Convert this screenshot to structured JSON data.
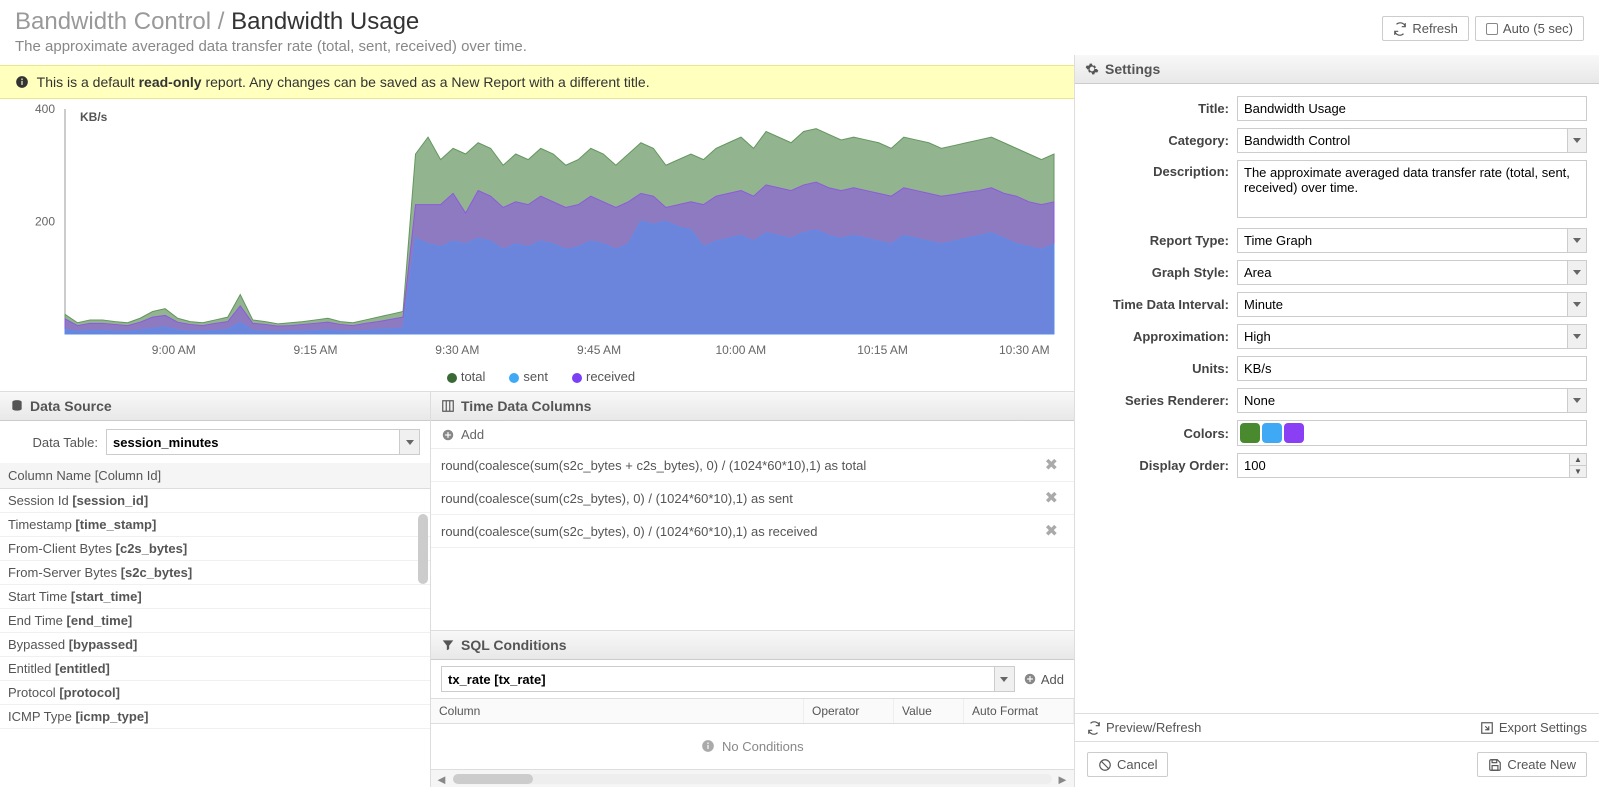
{
  "header": {
    "crumb_parent": "Bandwidth Control",
    "crumb_sep": " / ",
    "crumb_current": "Bandwidth Usage",
    "subtitle": "The approximate averaged data transfer rate (total, sent, received) over time.",
    "refresh_label": "Refresh",
    "auto_label": "Auto (5 sec)"
  },
  "notice": {
    "pre": "This is a default ",
    "bold": "read-only",
    "post": " report. Any changes can be saved as a New Report with a different title."
  },
  "chart_data": {
    "type": "area",
    "units": "KB/s",
    "ylim": [
      0,
      400
    ],
    "yticks": [
      200,
      400
    ],
    "x_labels": [
      "9:00 AM",
      "9:15 AM",
      "9:30 AM",
      "9:45 AM",
      "10:00 AM",
      "10:15 AM",
      "10:30 AM"
    ],
    "legend": [
      {
        "name": "total",
        "color": "#396a35"
      },
      {
        "name": "sent",
        "color": "#3fa9f5"
      },
      {
        "name": "received",
        "color": "#7b3ff5"
      }
    ],
    "series": {
      "total": [
        35,
        20,
        25,
        25,
        22,
        20,
        28,
        40,
        45,
        28,
        22,
        20,
        25,
        30,
        70,
        25,
        22,
        18,
        20,
        22,
        25,
        28,
        22,
        20,
        25,
        30,
        35,
        40,
        320,
        350,
        310,
        330,
        320,
        340,
        330,
        300,
        320,
        310,
        330,
        320,
        300,
        310,
        330,
        320,
        300,
        320,
        340,
        330,
        300,
        310,
        320,
        310,
        330,
        340,
        350,
        330,
        360,
        350,
        340,
        360,
        365,
        355,
        345,
        350,
        345,
        340,
        330,
        350,
        345,
        340,
        330,
        335,
        340,
        345,
        350,
        340,
        330,
        320,
        310,
        320
      ],
      "sent": [
        8,
        5,
        6,
        6,
        5,
        5,
        7,
        10,
        12,
        7,
        5,
        5,
        6,
        8,
        20,
        6,
        5,
        4,
        5,
        5,
        6,
        7,
        5,
        5,
        6,
        8,
        9,
        10,
        170,
        160,
        155,
        165,
        160,
        170,
        165,
        150,
        160,
        155,
        165,
        160,
        150,
        155,
        165,
        160,
        150,
        160,
        200,
        195,
        200,
        190,
        185,
        155,
        165,
        170,
        175,
        165,
        180,
        175,
        170,
        180,
        185,
        175,
        170,
        175,
        170,
        165,
        160,
        175,
        170,
        165,
        160,
        165,
        170,
        175,
        180,
        170,
        160,
        155,
        150,
        160
      ],
      "received": [
        27,
        15,
        19,
        19,
        17,
        15,
        21,
        30,
        33,
        21,
        17,
        15,
        19,
        22,
        50,
        19,
        17,
        14,
        15,
        17,
        19,
        21,
        17,
        15,
        19,
        22,
        26,
        30,
        230,
        230,
        230,
        250,
        215,
        255,
        245,
        225,
        235,
        230,
        245,
        235,
        225,
        230,
        245,
        235,
        225,
        235,
        250,
        245,
        225,
        230,
        235,
        230,
        245,
        250,
        255,
        245,
        265,
        260,
        255,
        265,
        270,
        260,
        255,
        260,
        255,
        250,
        245,
        260,
        255,
        250,
        245,
        248,
        252,
        255,
        260,
        250,
        245,
        235,
        230,
        235
      ]
    }
  },
  "datasource": {
    "header": "Data Source",
    "table_label": "Data Table:",
    "table_value": "session_minutes",
    "col_header": "Column Name [Column Id]",
    "columns": [
      "Session Id [session_id]",
      "Timestamp [time_stamp]",
      "From-Client Bytes [c2s_bytes]",
      "From-Server Bytes [s2c_bytes]",
      "Start Time [start_time]",
      "End Time [end_time]",
      "Bypassed [bypassed]",
      "Entitled [entitled]",
      "Protocol [protocol]",
      "ICMP Type [icmp_type]"
    ]
  },
  "tdc": {
    "header": "Time Data Columns",
    "add": "Add",
    "exprs": [
      "round(coalesce(sum(s2c_bytes + c2s_bytes), 0) / (1024*60*10),1) as total",
      "round(coalesce(sum(c2s_bytes), 0) / (1024*60*10),1) as sent",
      "round(coalesce(sum(s2c_bytes), 0) / (1024*60*10),1) as received"
    ]
  },
  "sql": {
    "header": "SQL Conditions",
    "combo": "tx_rate [tx_rate]",
    "add": "Add",
    "cols": [
      "Column",
      "Operator",
      "Value",
      "Auto Format"
    ],
    "empty": "No Conditions"
  },
  "settings": {
    "header": "Settings",
    "title_lbl": "Title:",
    "title_val": "Bandwidth Usage",
    "cat_lbl": "Category:",
    "cat_val": "Bandwidth Control",
    "desc_lbl": "Description:",
    "desc_val": "The approximate averaged data transfer rate (total, sent, received) over time.",
    "rtype_lbl": "Report Type:",
    "rtype_val": "Time Graph",
    "gstyle_lbl": "Graph Style:",
    "gstyle_val": "Area",
    "tdi_lbl": "Time Data Interval:",
    "tdi_val": "Minute",
    "approx_lbl": "Approximation:",
    "approx_val": "High",
    "units_lbl": "Units:",
    "units_val": "KB/s",
    "srender_lbl": "Series Renderer:",
    "srender_val": "None",
    "colors_lbl": "Colors:",
    "colors": [
      "#4a8a2f",
      "#3fa9f5",
      "#8a3ff5"
    ],
    "dorder_lbl": "Display Order:",
    "dorder_val": "100",
    "preview": "Preview/Refresh",
    "export": "Export Settings",
    "cancel": "Cancel",
    "create": "Create New"
  }
}
